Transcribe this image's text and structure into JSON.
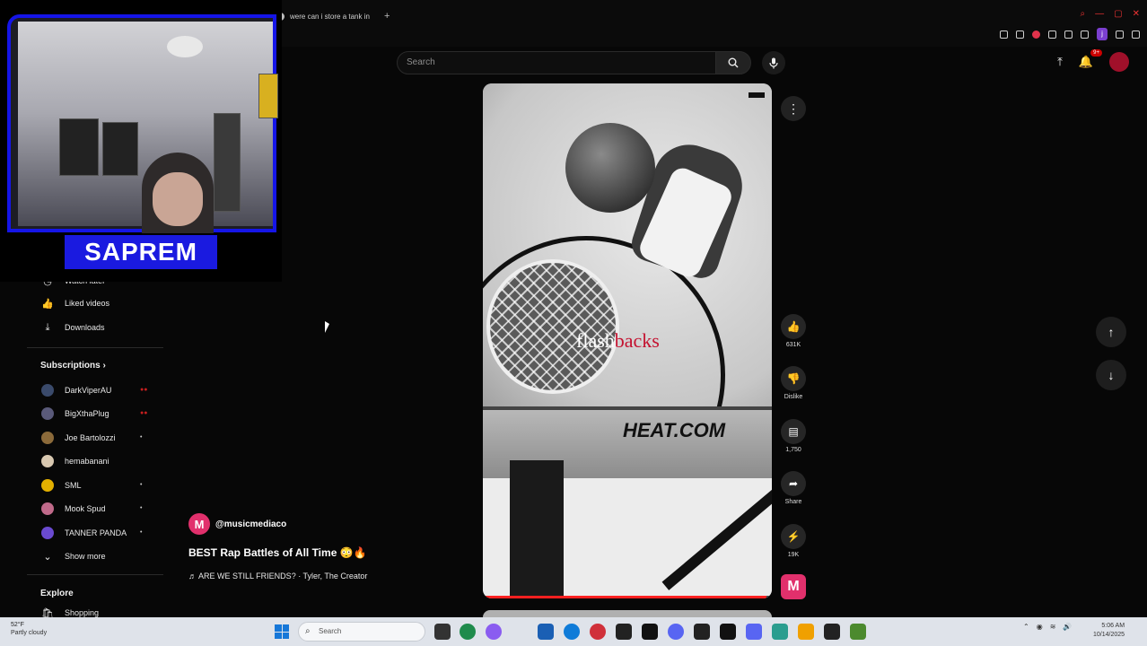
{
  "browser": {
    "tab_title": "were can i store a tank in",
    "new_tab_icon": "plus-icon"
  },
  "header": {
    "search_placeholder": "Search",
    "notification_count": "9+"
  },
  "webcam": {
    "streamer_label": "SAPREM"
  },
  "sidebar": {
    "items": [
      {
        "label": "Watch later",
        "icon": "clock-icon"
      },
      {
        "label": "Liked videos",
        "icon": "thumbs-up-icon"
      },
      {
        "label": "Downloads",
        "icon": "download-icon"
      }
    ],
    "subscriptions_heading": "Subscriptions",
    "subscriptions": [
      {
        "name": "DarkViperAU",
        "color": "#3a4a6b"
      },
      {
        "name": "BigXthaPlug",
        "color": "#5a5a7a"
      },
      {
        "name": "Joe Bartolozzi",
        "color": "#8b6a3a"
      },
      {
        "name": "hemabanani",
        "color": "#d8c8b0"
      },
      {
        "name": "SML",
        "color": "#e3b000"
      },
      {
        "name": "Mook Spud",
        "color": "#c06a8a"
      },
      {
        "name": "TANNER PANDA",
        "color": "#6a4ad0"
      }
    ],
    "show_more": "Show more",
    "explore_heading": "Explore",
    "explore_items": [
      {
        "label": "Shopping"
      }
    ]
  },
  "video": {
    "channel_handle": "@musicmediaco",
    "channel_initial": "M",
    "title": "BEST Rap Battles of All Time 😳🔥",
    "music": "♬ ARE WE STILL FRIENDS? · Tyler, The Creator",
    "overlay_text_main": "flash",
    "overlay_text_accent": "backs",
    "court_text": "HEAT.COM",
    "progress": 0.98
  },
  "actions": {
    "like_count": "631K",
    "dislike_label": "Dislike",
    "comment_count": "1,750",
    "share_label": "Share",
    "remix_count": "19K"
  },
  "taskbar": {
    "weather_temp": "52°F",
    "weather_desc": "Partly cloudy",
    "search_placeholder": "Search",
    "time": "5:06 AM",
    "date": "10/14/2025"
  }
}
